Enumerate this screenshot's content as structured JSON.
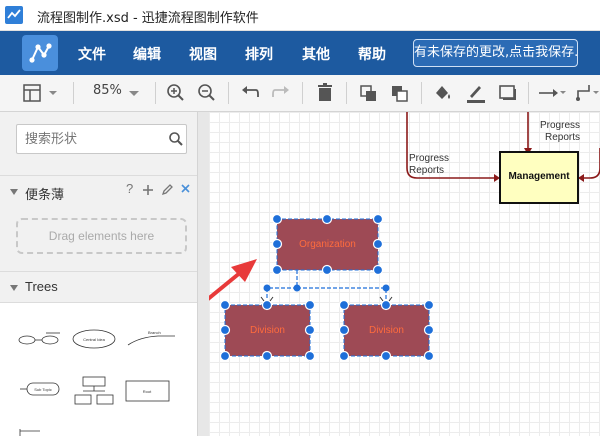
{
  "window": {
    "title": "流程图制作.xsd - 迅捷流程图制作软件"
  },
  "menu": {
    "items": [
      {
        "label": "文件"
      },
      {
        "label": "编辑"
      },
      {
        "label": "视图"
      },
      {
        "label": "排列"
      },
      {
        "label": "其他"
      },
      {
        "label": "帮助"
      }
    ],
    "save_notice": "有未保存的更改,点击我保存."
  },
  "toolbar": {
    "zoom_value": "85%"
  },
  "sidebar": {
    "search_placeholder": "搜索形状",
    "scratchpad": {
      "title": "便条薄",
      "drag_hint": "Drag elements here"
    },
    "trees": {
      "title": "Trees",
      "thumbnails": {
        "central_idea": "Central Idea",
        "branch": "Branch",
        "sub_topic": "Sub Topic",
        "root": "Root"
      }
    }
  },
  "diagram": {
    "nodes": {
      "management": "Management",
      "organization": "Organization",
      "division_left": "Division",
      "division_right": "Division"
    },
    "edge_labels": {
      "progress_reports_left": "Progress\nReports",
      "progress_reports_right": "Progress\nReports"
    },
    "colors": {
      "org_fill": "#9e4a55",
      "org_text": "#ff6b3d",
      "mgmt_fill": "#ffffc0",
      "selection": "#1e6fd9",
      "arrow": "#8b1a1a",
      "annotation_arrow": "#e83a3a"
    }
  }
}
